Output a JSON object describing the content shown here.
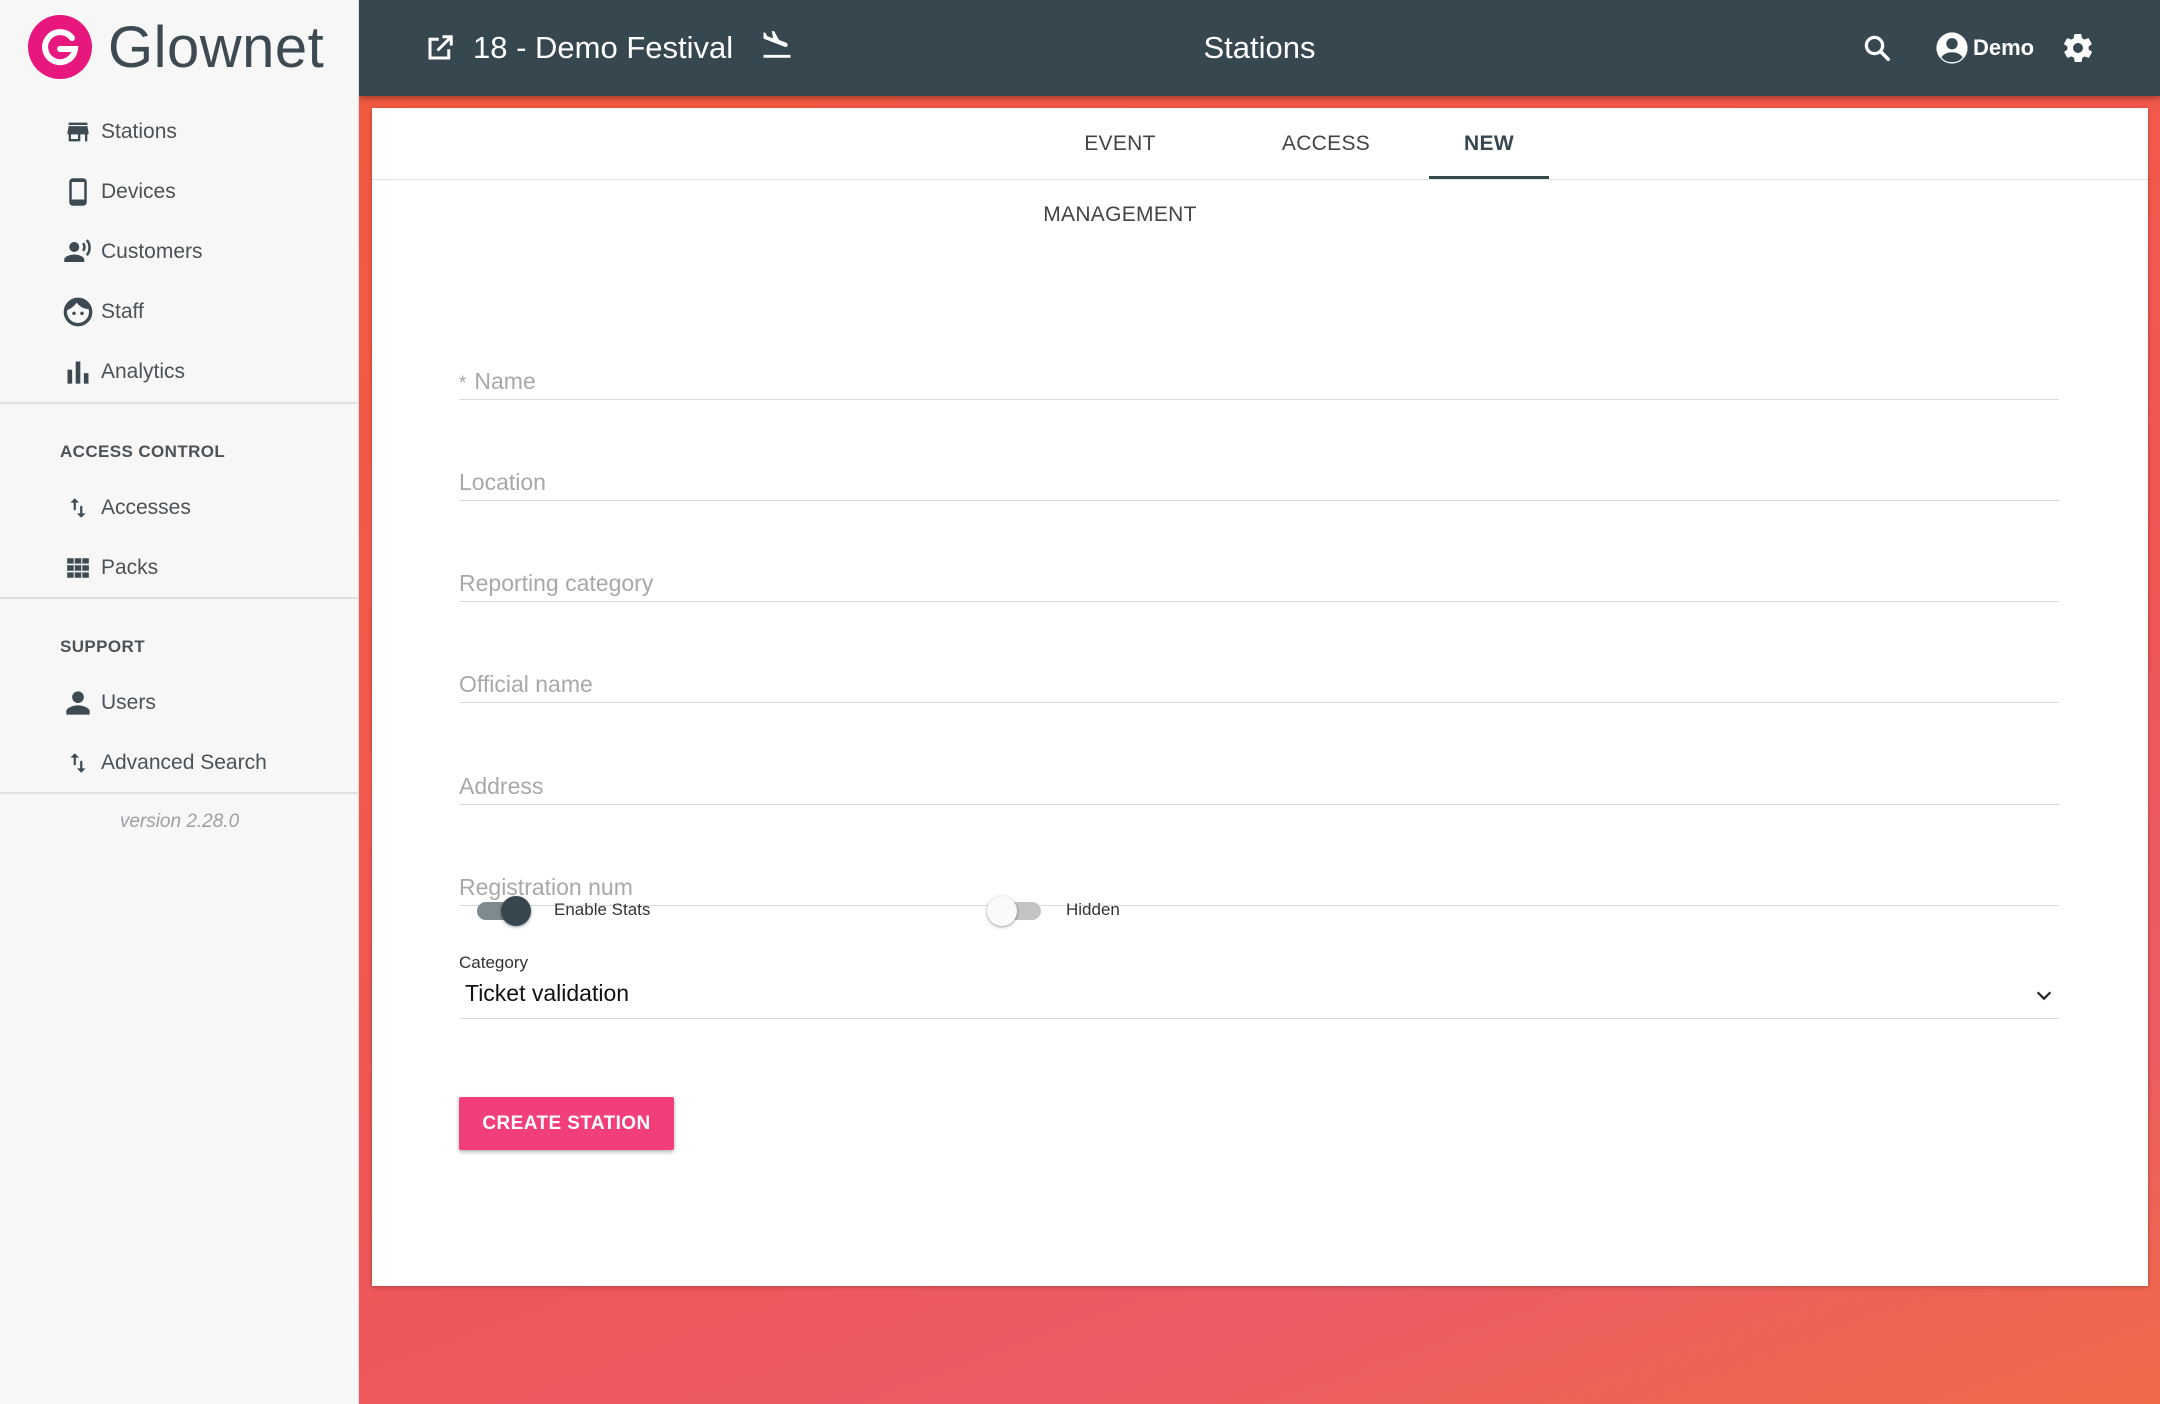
{
  "brand": {
    "name": "Glownet",
    "color": "#e8177d"
  },
  "sidebar": {
    "items": [
      {
        "label": "Stations",
        "icon": "store-icon"
      },
      {
        "label": "Devices",
        "icon": "smartphone-icon"
      },
      {
        "label": "Customers",
        "icon": "customers-icon"
      },
      {
        "label": "Staff",
        "icon": "face-icon"
      },
      {
        "label": "Analytics",
        "icon": "bar-chart-icon"
      }
    ],
    "sections": [
      {
        "title": "ACCESS CONTROL",
        "items": [
          {
            "label": "Accesses",
            "icon": "swap-vert-icon"
          },
          {
            "label": "Packs",
            "icon": "grid-icon"
          }
        ]
      },
      {
        "title": "SUPPORT",
        "items": [
          {
            "label": "Users",
            "icon": "person-icon"
          },
          {
            "label": "Advanced Search",
            "icon": "swap-vert-icon"
          }
        ]
      }
    ],
    "version": "version 2.28.0"
  },
  "topbar": {
    "event_title": "18 - Demo Festival",
    "page_title": "Stations",
    "user": "Demo",
    "background": "#37474f"
  },
  "tabs": [
    {
      "label": "EVENT MANAGEMENT",
      "active": false
    },
    {
      "label": "ACCESS",
      "active": false
    },
    {
      "label": "NEW",
      "active": true
    }
  ],
  "form": {
    "required_marker": "*",
    "fields": [
      {
        "label": "Name",
        "required": true
      },
      {
        "label": "Location"
      },
      {
        "label": "Reporting category"
      },
      {
        "label": "Official name"
      },
      {
        "label": "Address"
      },
      {
        "label": "Registration num"
      }
    ],
    "toggles": [
      {
        "label": "Enable Stats",
        "on": true
      },
      {
        "label": "Hidden",
        "on": false
      }
    ],
    "category": {
      "label": "Category",
      "value": "Ticket validation"
    },
    "submit_label": "CREATE STATION",
    "submit_color": "#f23f7b"
  }
}
